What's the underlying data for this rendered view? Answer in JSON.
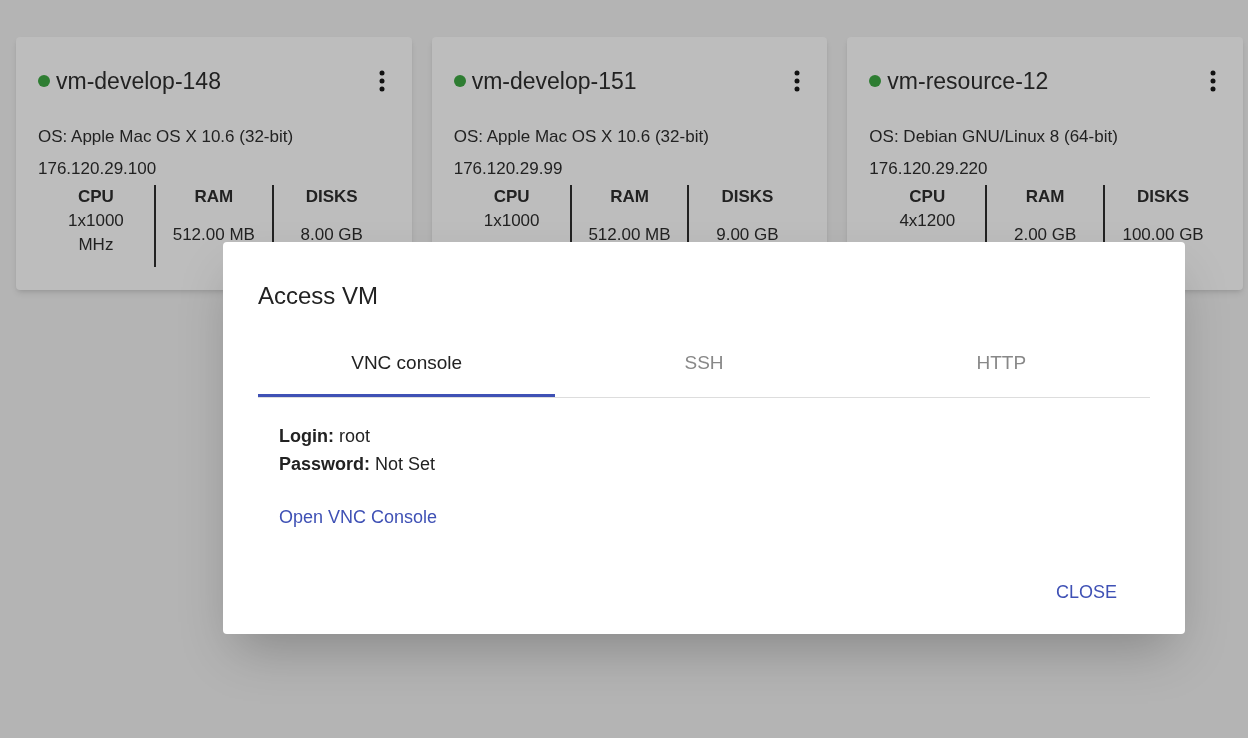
{
  "vms": [
    {
      "name": "vm-develop-148",
      "color": "#2e7d32",
      "os": "OS: Apple Mac OS X 10.6 (32-bit)",
      "ip": "176.120.29.100",
      "specs": [
        {
          "label": "CPU",
          "value": "1x1000 MHz"
        },
        {
          "label": "RAM",
          "value": "512.00 MB"
        },
        {
          "label": "DISKS",
          "value": "8.00 GB"
        }
      ]
    },
    {
      "name": "vm-develop-151",
      "color": "#2e7d32",
      "os": "OS: Apple Mac OS X 10.6 (32-bit)",
      "ip": "176.120.29.99",
      "specs": [
        {
          "label": "CPU",
          "value": "1x1000"
        },
        {
          "label": "RAM",
          "value": "512.00 MB"
        },
        {
          "label": "DISKS",
          "value": "9.00 GB"
        }
      ]
    },
    {
      "name": "vm-resource-12",
      "color": "#2e7d32",
      "os": "OS: Debian GNU/Linux 8 (64-bit)",
      "ip": "176.120.29.220",
      "specs": [
        {
          "label": "CPU",
          "value": "4x1200"
        },
        {
          "label": "RAM",
          "value": "2.00 GB"
        },
        {
          "label": "DISKS",
          "value": "100.00 GB"
        }
      ]
    }
  ],
  "dialog": {
    "title": "Access VM",
    "tabs": [
      {
        "label": "VNC console",
        "selected": true
      },
      {
        "label": "SSH",
        "selected": false
      },
      {
        "label": "HTTP",
        "selected": false
      }
    ],
    "fields": [
      {
        "label": "Login:",
        "value": "root"
      },
      {
        "label": "Password:",
        "value": "Not Set"
      }
    ],
    "link": "Open VNC Console",
    "close_button": "CLOSE"
  }
}
